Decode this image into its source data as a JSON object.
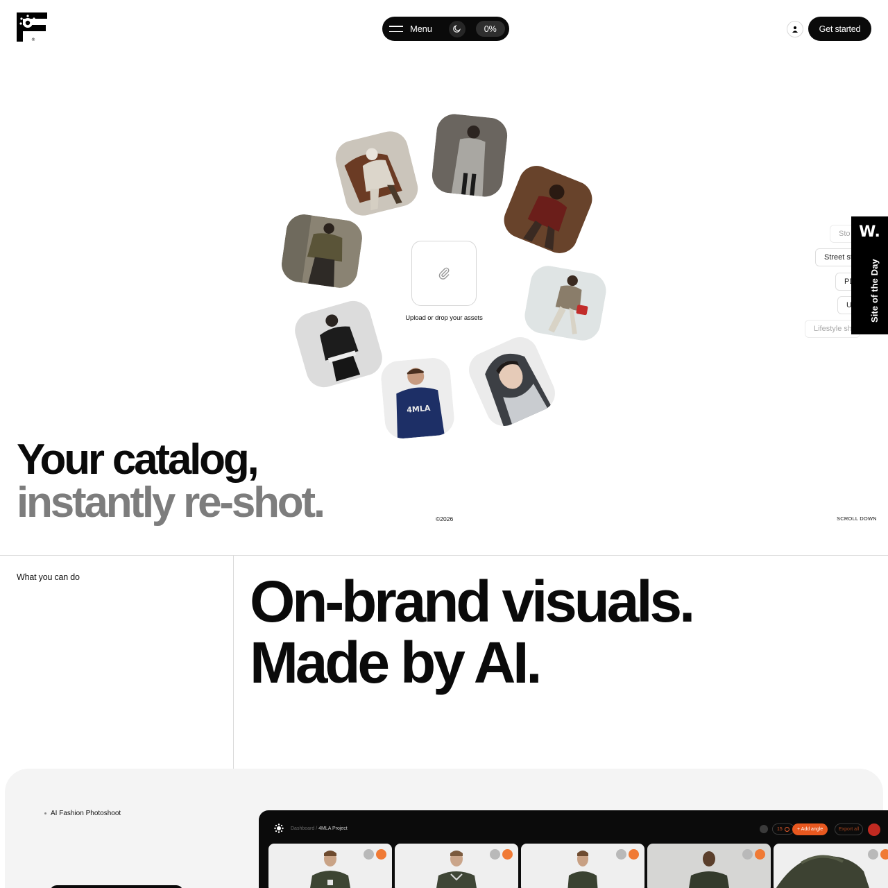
{
  "header": {
    "menu_label": "Menu",
    "progress": "0%",
    "cta_label": "Get started",
    "logo_icon": "brand-logo-icon",
    "account_icon": "user-icon",
    "theme_icon": "moon-icon"
  },
  "hero": {
    "upload_caption": "Upload or drop your assets",
    "upload_icon": "paperclip-icon",
    "title_line1": "Your catalog,",
    "title_line2": "instantly re-shot.",
    "copyright": "©2026",
    "scroll_down": "SCROLL DOWN",
    "style_chips": [
      "Sto",
      "Street st",
      "PD",
      "U",
      "Lifestyle sh"
    ]
  },
  "award": {
    "logo": "W.",
    "label": "Site of the Day"
  },
  "features": {
    "section_label": "What you can do",
    "title_line1": "On-brand visuals.",
    "title_line2": "Made by AI.",
    "panel_label": "AI Fashion Photoshoot"
  },
  "app_preview": {
    "breadcrumb_root": "Dashboard",
    "breadcrumb_sep": "/",
    "breadcrumb_current": "4MLA Project",
    "count": "15",
    "add_label": "+ Add angle",
    "export_label": "Export all"
  },
  "colors": {
    "ink": "#0a0a0a",
    "muted_headline": "#7d7d7d",
    "accent": "#e8581f",
    "panel_bg": "#f4f4f4"
  }
}
